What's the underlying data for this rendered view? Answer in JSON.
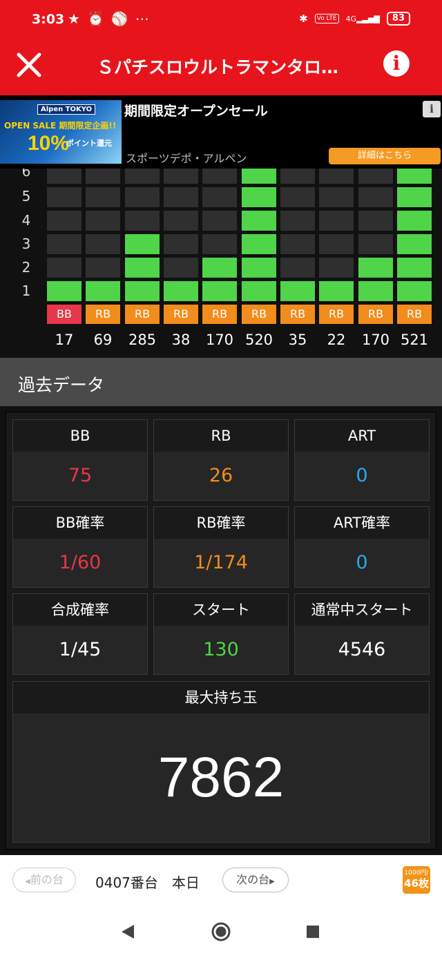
{
  "status_bar": {
    "time": "3:03",
    "left_icons": [
      "star-icon",
      "alarm-icon",
      "ball-icon",
      "more-dots-icon"
    ],
    "network": "4G",
    "volte": "Vo LTE",
    "battery": "83"
  },
  "app_bar": {
    "title": "Ｓパチスロウルトラマンタロ…"
  },
  "ad": {
    "image_texts": {
      "brand": "Alpen TOKYO",
      "sale": "OPEN SALE 期間限定企画!!",
      "percent": "10%",
      "points": "ポイント還元"
    },
    "title": "期間限定オープンセール",
    "advertiser": "スポーツデポ・アルペン",
    "button": "詳細はこちら"
  },
  "chart": {
    "y_labels": [
      "5",
      "4",
      "3",
      "2",
      "1"
    ],
    "colors": {
      "filled": "#4fd44a",
      "empty": "#2f2f2f",
      "bb": "#e8364a",
      "rb": "#f28c1c"
    },
    "columns": [
      {
        "type": "BB",
        "games": "17",
        "level": 1
      },
      {
        "type": "RB",
        "games": "69",
        "level": 1
      },
      {
        "type": "RB",
        "games": "285",
        "level": 3
      },
      {
        "type": "RB",
        "games": "38",
        "level": 1
      },
      {
        "type": "RB",
        "games": "170",
        "level": 2
      },
      {
        "type": "RB",
        "games": "520",
        "level": 6
      },
      {
        "type": "RB",
        "games": "35",
        "level": 1
      },
      {
        "type": "RB",
        "games": "22",
        "level": 1
      },
      {
        "type": "RB",
        "games": "170",
        "level": 2
      },
      {
        "type": "RB",
        "games": "521",
        "level": 6
      }
    ]
  },
  "section": {
    "title": "過去データ"
  },
  "stats": {
    "bb": {
      "label": "BB",
      "value": "75",
      "color": "#e8364a"
    },
    "rb": {
      "label": "RB",
      "value": "26",
      "color": "#f28c1c"
    },
    "art": {
      "label": "ART",
      "value": "0",
      "color": "#29a8e8"
    },
    "bb_prob": {
      "label": "BB確率",
      "value": "1/60",
      "color": "#e8364a"
    },
    "rb_prob": {
      "label": "RB確率",
      "value": "1/174",
      "color": "#f28c1c"
    },
    "art_prob": {
      "label": "ART確率",
      "value": "0",
      "color": "#29a8e8"
    },
    "combined": {
      "label": "合成確率",
      "value": "1/45",
      "color": "#ffffff"
    },
    "start": {
      "label": "スタート",
      "value": "130",
      "color": "#4fd44a"
    },
    "normal_start": {
      "label": "通常中スタート",
      "value": "4546",
      "color": "#ffffff"
    }
  },
  "max_balls": {
    "label": "最大持ち玉",
    "value": "7862"
  },
  "bottom_nav": {
    "prev": "前の台",
    "machine": "0407番台　本日",
    "next": "次の台",
    "coin_top": "1000円/",
    "coin_bottom": "46枚"
  }
}
